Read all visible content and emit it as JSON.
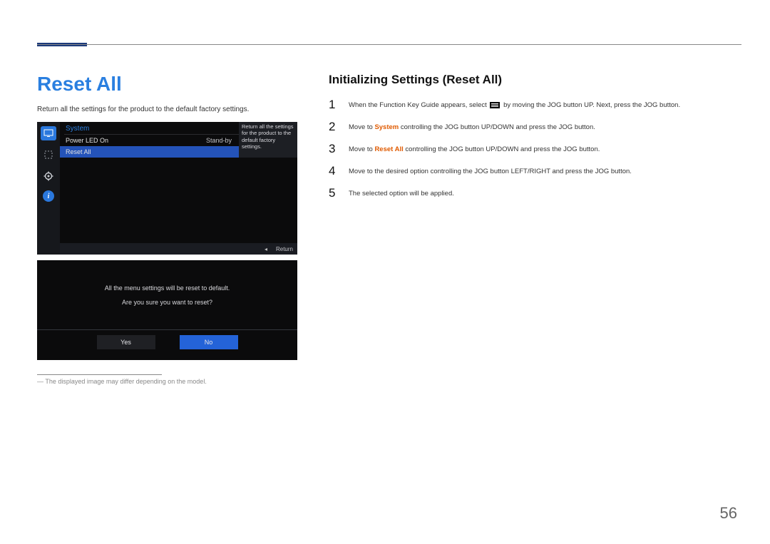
{
  "heading": "Reset All",
  "intro": "Return all the settings for the product to the default factory settings.",
  "osd": {
    "title": "System",
    "power_led_label": "Power LED On",
    "power_led_value": "Stand-by",
    "reset_all_label": "Reset All",
    "info_text": "Return all the settings for the product to the default factory settings.",
    "return_label": "Return"
  },
  "dialog": {
    "line1": "All the menu settings will be reset to default.",
    "line2": "Are you sure you want to reset?",
    "yes": "Yes",
    "no": "No"
  },
  "footnote": "― The displayed image may differ depending on the model.",
  "subheading": "Initializing Settings (Reset All)",
  "steps": {
    "s1a": "When the Function Key Guide appears, select ",
    "s1b": " by moving the JOG button UP. Next, press the JOG button.",
    "s2a": "Move to ",
    "s2hl": "System",
    "s2b": " controlling the JOG button UP/DOWN and press the JOG button.",
    "s3a": "Move to ",
    "s3hl": "Reset All",
    "s3b": " controlling the JOG button UP/DOWN and press the JOG button.",
    "s4": "Move to the desired option controlling the JOG button LEFT/RIGHT and press the JOG button.",
    "s5": "The selected option will be applied."
  },
  "nums": {
    "n1": "1",
    "n2": "2",
    "n3": "3",
    "n4": "4",
    "n5": "5"
  },
  "page_number": "56"
}
